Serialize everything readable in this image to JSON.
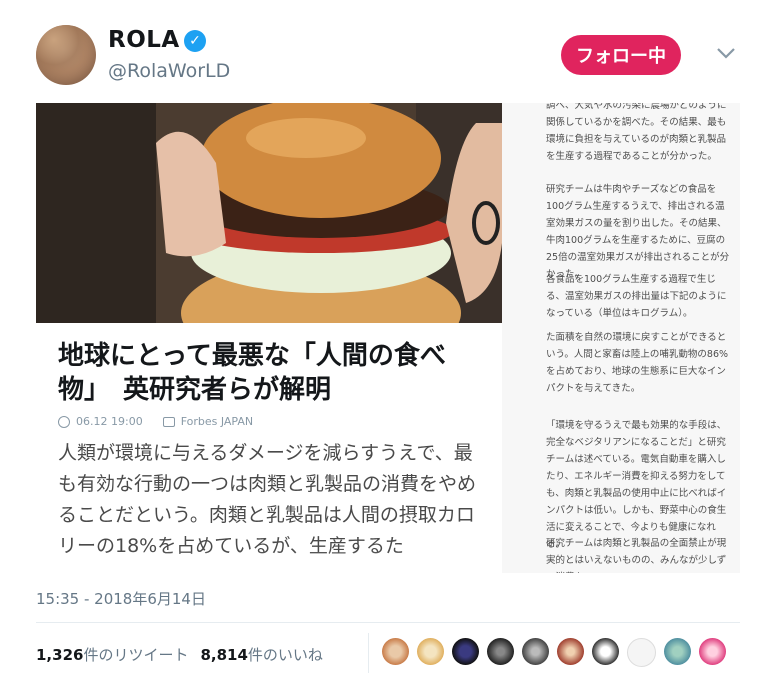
{
  "user": {
    "name": "ROLA",
    "verified_mark": "✓",
    "handle": "@RolaWorLD",
    "follow_label": "フォロー中"
  },
  "article": {
    "title": "地球にとって最悪な「人間の食べ物」　英研究者らが解明",
    "date": "06.12 19:00",
    "source": "Forbes JAPAN",
    "body": "人類が環境に与えるダメージを減らすうえで、最も有効な行動の一つは肉類と乳製品の消費をやめることだという。肉類と乳製品は人間の摂取カロリーの18%を占めているが、生産するた"
  },
  "side_text": {
    "b1": "調べ、大気や水の汚染に農場がどのように関係しているかを調べた。その結果、最も環境に負担を与えているのが肉類と乳製品を生産する過程であることが分かった。",
    "b2": "研究チームは牛肉やチーズなどの食品を100グラム生産するうえで、排出される温室効果ガスの量を割り出した。その結果、牛肉100グラムを生産するために、豆腐の25倍の温室効果ガスが排出されることが分かった。",
    "b3": "各食品を100グラム生産する過程で生じる、温室効果ガスの排出量は下記のようになっている（単位はキログラム）。",
    "b4": "た面積を自然の環境に戻すことができるという。人間と家畜は陸上の哺乳動物の86%を占めており、地球の生態系に巨大なインパクトを与えてきた。",
    "b5": "「環境を守るうえで最も効果的な手段は、完全なベジタリアンになることだ」と研究チームは述べている。電気自動車を購入したり、エネルギー消費を抑える努力をしても、肉類と乳製品の使用中止に比べればインパクトは低い。しかも、野菜中心の食生活に変えることで、今よりも健康になれる。",
    "b6": "研究チームは肉類と乳製品の全面禁止が現実的とはいえないものの、みんなが少しずつ消費を"
  },
  "timestamp": "15:35 - 2018年6月14日",
  "stats": {
    "retweets_count": "1,326",
    "retweets_label": "件のリツイート",
    "likes_count": "8,814",
    "likes_label": "件のいいね"
  },
  "colors": {
    "follow": "#e0245e",
    "verified": "#1da1f2",
    "muted": "#657786"
  }
}
